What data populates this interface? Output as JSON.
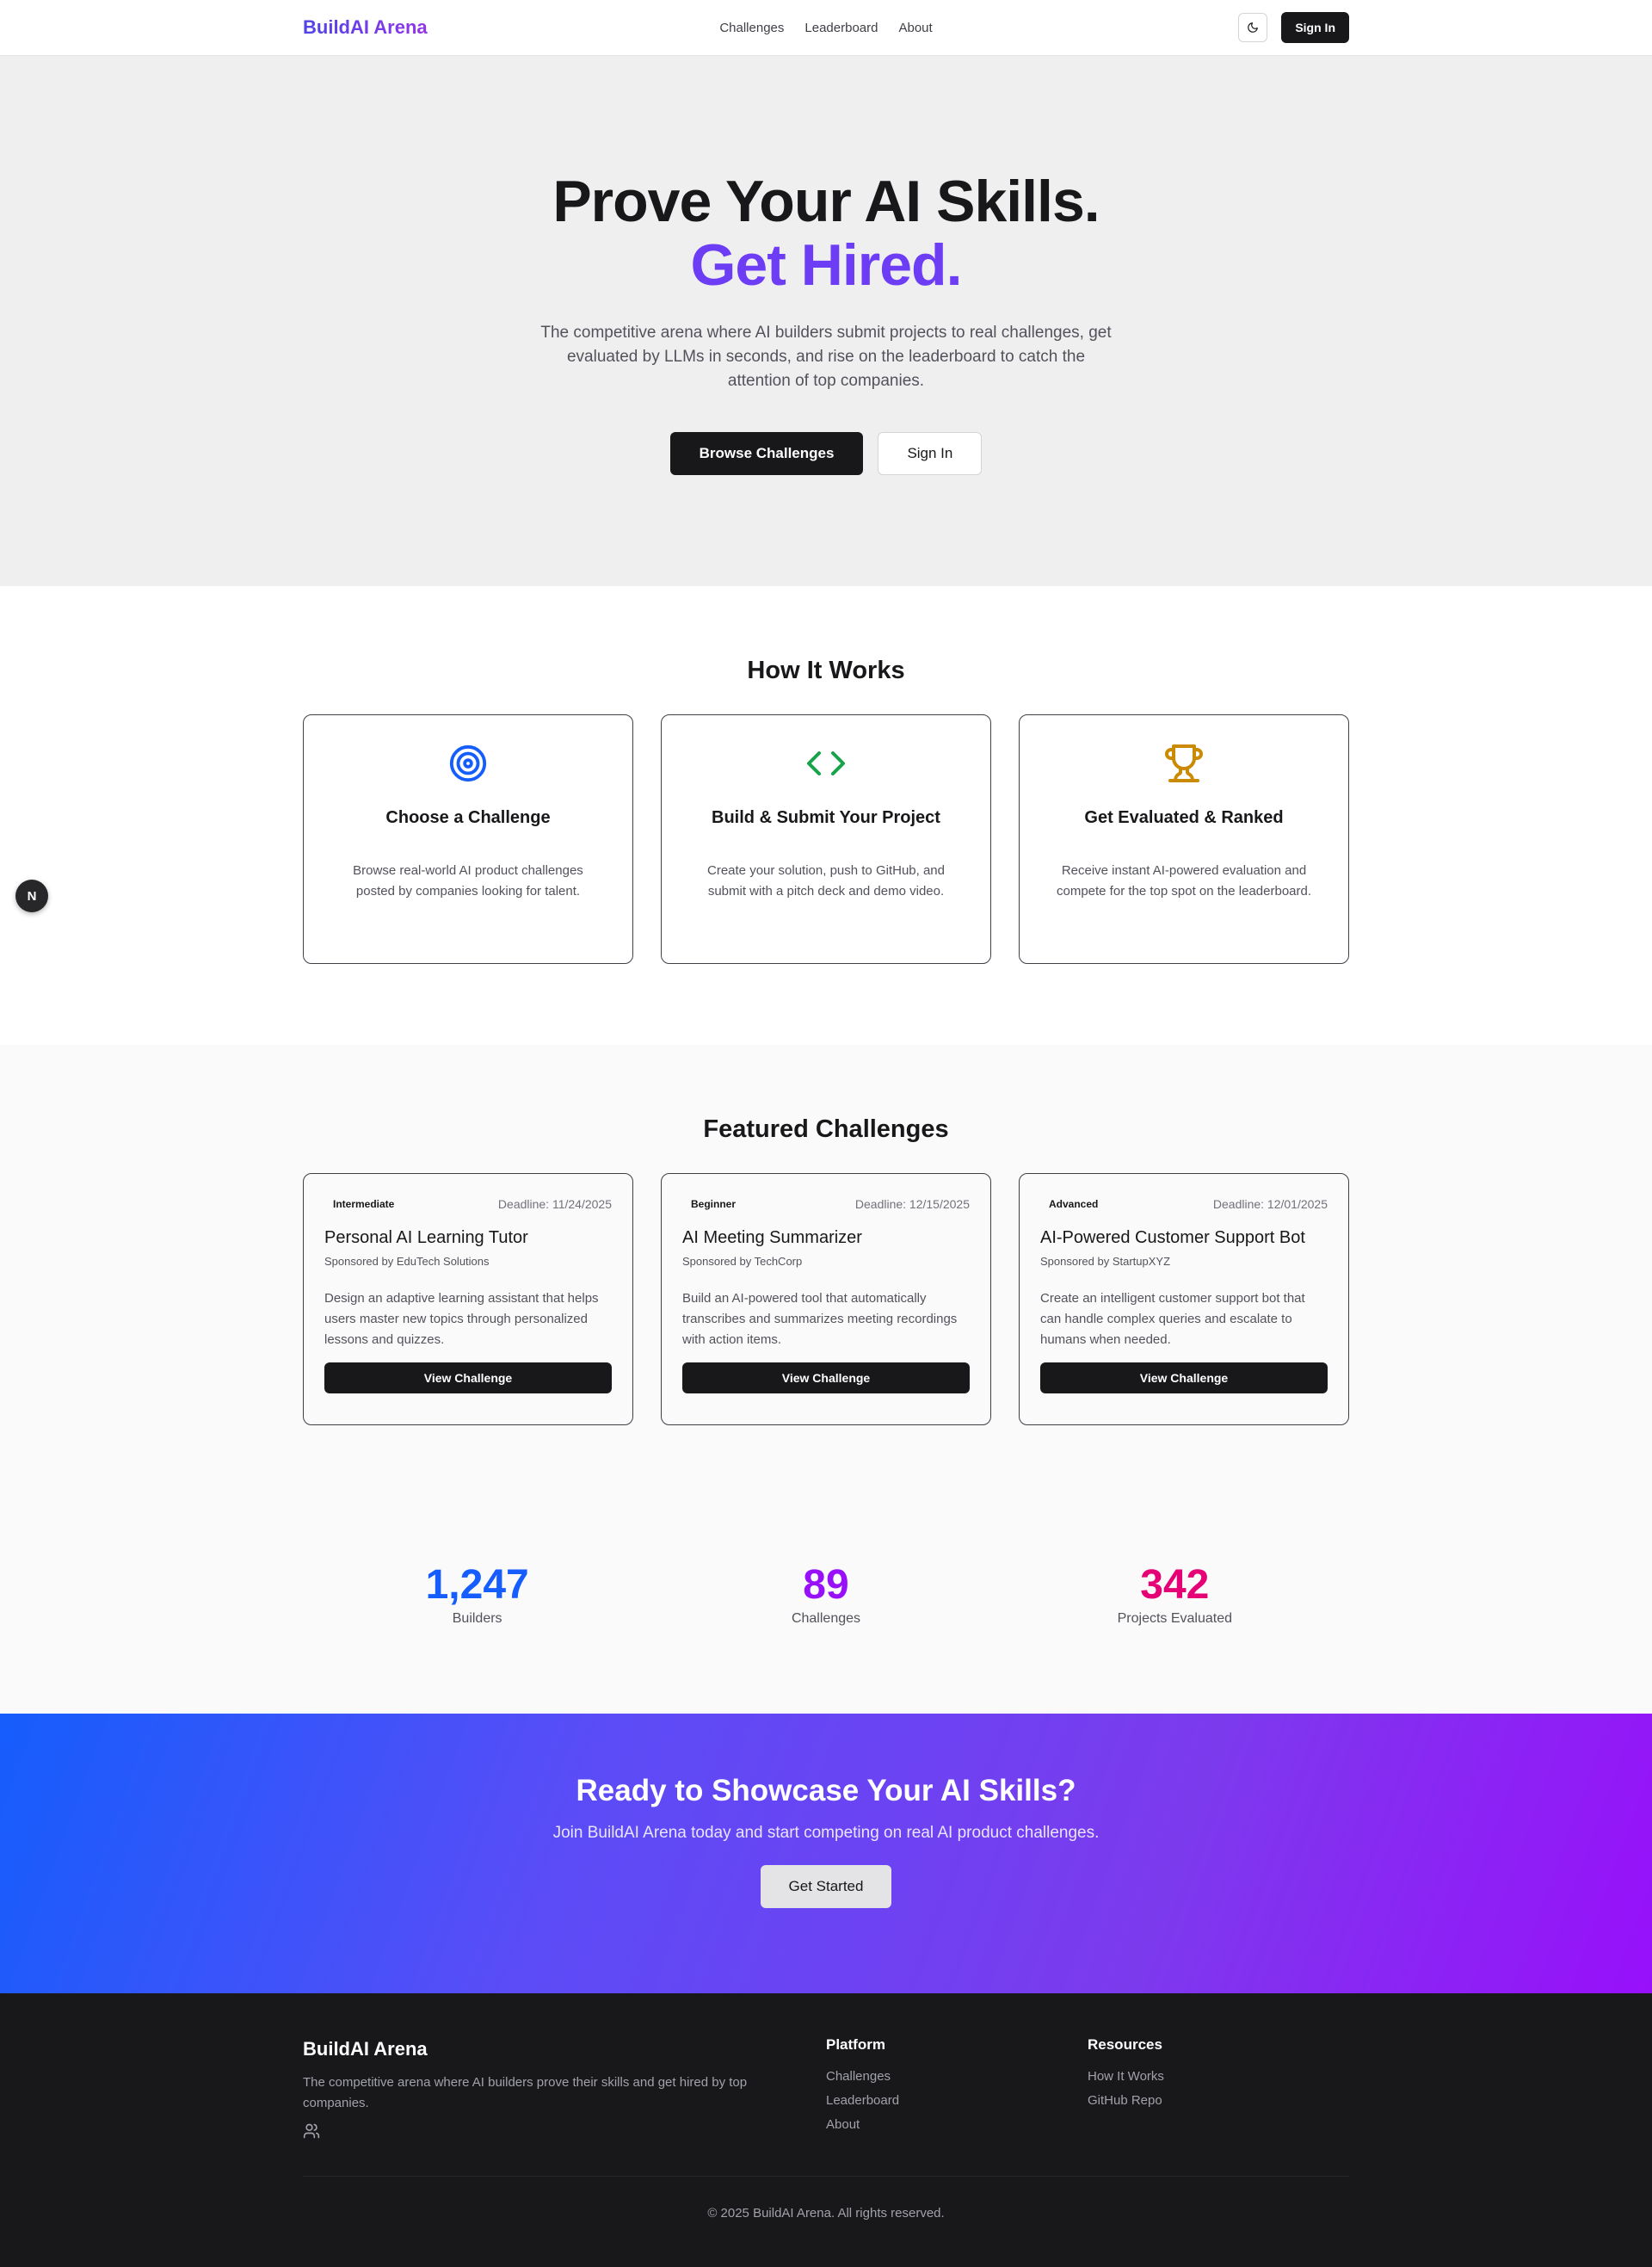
{
  "nav": {
    "brand": "BuildAI Arena",
    "links": [
      "Challenges",
      "Leaderboard",
      "About"
    ],
    "sign_in": "Sign In"
  },
  "hero": {
    "title_line1": "Prove Your AI Skills.",
    "title_line2": "Get Hired.",
    "subtitle": "The competitive arena where AI builders submit projects to real challenges, get evaluated by LLMs in seconds, and rise on the leaderboard to catch the attention of top companies.",
    "primary_button": "Browse Challenges",
    "secondary_button": "Sign In"
  },
  "how": {
    "title": "How It Works",
    "steps": [
      {
        "icon": "target-icon",
        "title": "Choose a Challenge",
        "desc": "Browse real-world AI product challenges posted by companies looking for talent.",
        "color": "#155dfc"
      },
      {
        "icon": "code-icon",
        "title": "Build & Submit Your Project",
        "desc": "Create your solution, push to GitHub, and submit with a pitch deck and demo video.",
        "color": "#16a34a"
      },
      {
        "icon": "trophy-icon",
        "title": "Get Evaluated & Ranked",
        "desc": "Receive instant AI-powered evaluation and compete for the top spot on the leaderboard.",
        "color": "#ca8a04"
      }
    ]
  },
  "side_badge": "N",
  "featured": {
    "title": "Featured Challenges",
    "challenges": [
      {
        "level": "Intermediate",
        "deadline": "Deadline: 11/24/2025",
        "title": "Personal AI Learning Tutor",
        "sponsor": "Sponsored by EduTech Solutions",
        "desc": "Design an adaptive learning assistant that helps users master new topics through personalized lessons and quizzes.",
        "button": "View Challenge"
      },
      {
        "level": "Beginner",
        "deadline": "Deadline: 12/15/2025",
        "title": "AI Meeting Summarizer",
        "sponsor": "Sponsored by TechCorp",
        "desc": "Build an AI-powered tool that automatically transcribes and summarizes meeting recordings with action items.",
        "button": "View Challenge"
      },
      {
        "level": "Advanced",
        "deadline": "Deadline: 12/01/2025",
        "title": "AI-Powered Customer Support Bot",
        "sponsor": "Sponsored by StartupXYZ",
        "desc": "Create an intelligent customer support bot that can handle complex queries and escalate to humans when needed.",
        "button": "View Challenge"
      }
    ]
  },
  "stats": [
    {
      "value": "1,247",
      "label": "Builders",
      "color": "#155dfc"
    },
    {
      "value": "89",
      "label": "Challenges",
      "color": "#9810fa"
    },
    {
      "value": "342",
      "label": "Projects Evaluated",
      "color": "#e60076"
    }
  ],
  "cta": {
    "title": "Ready to Showcase Your AI Skills?",
    "subtitle": "Join BuildAI Arena today and start competing on real AI product challenges.",
    "button": "Get Started"
  },
  "footer": {
    "brand": "BuildAI Arena",
    "tagline": "The competitive arena where AI builders prove their skills and get hired by top companies.",
    "social_icon": "users-icon",
    "platform_title": "Platform",
    "platform_links": [
      "Challenges",
      "Leaderboard",
      "About"
    ],
    "resources_title": "Resources",
    "resources_links": [
      "How It Works",
      "GitHub Repo"
    ],
    "copyright": "© 2025 BuildAI Arena. All rights reserved."
  }
}
